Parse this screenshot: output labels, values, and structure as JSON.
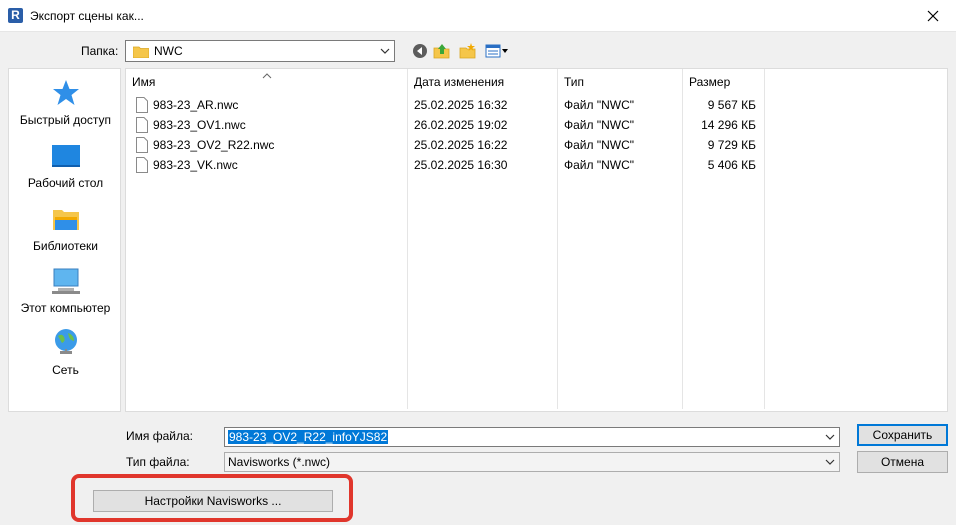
{
  "window": {
    "app_icon_letter": "R",
    "title": "Экспорт сцены как..."
  },
  "location": {
    "label": "Папка:",
    "folder": "NWC"
  },
  "places": [
    {
      "label": "Быстрый доступ",
      "icon": "quick-access-star-icon"
    },
    {
      "label": "Рабочий стол",
      "icon": "desktop-icon"
    },
    {
      "label": "Библиотеки",
      "icon": "libraries-icon"
    },
    {
      "label": "Этот компьютер",
      "icon": "this-pc-icon"
    },
    {
      "label": "Сеть",
      "icon": "network-icon"
    }
  ],
  "columns": {
    "name": "Имя",
    "date": "Дата изменения",
    "type": "Тип",
    "size": "Размер"
  },
  "files": [
    {
      "name": "983-23_AR.nwc",
      "date": "25.02.2025 16:32",
      "type": "Файл \"NWC\"",
      "size": "9 567 КБ"
    },
    {
      "name": "983-23_OV1.nwc",
      "date": "26.02.2025 19:02",
      "type": "Файл \"NWC\"",
      "size": "14 296 КБ"
    },
    {
      "name": "983-23_OV2_R22.nwc",
      "date": "25.02.2025 16:22",
      "type": "Файл \"NWC\"",
      "size": "9 729 КБ"
    },
    {
      "name": "983-23_VK.nwc",
      "date": "25.02.2025 16:30",
      "type": "Файл \"NWC\"",
      "size": "5 406 КБ"
    }
  ],
  "filename": {
    "label": "Имя файла:",
    "value": "983-23_OV2_R22_infoYJS82"
  },
  "filetype": {
    "label": "Тип файла:",
    "value": "Navisworks (*.nwc)"
  },
  "buttons": {
    "save": "Сохранить",
    "cancel": "Отмена",
    "navis_settings": "Настройки Navisworks ..."
  },
  "colors": {
    "selection": "#0078d7",
    "highlight_frame": "#e0362c"
  }
}
